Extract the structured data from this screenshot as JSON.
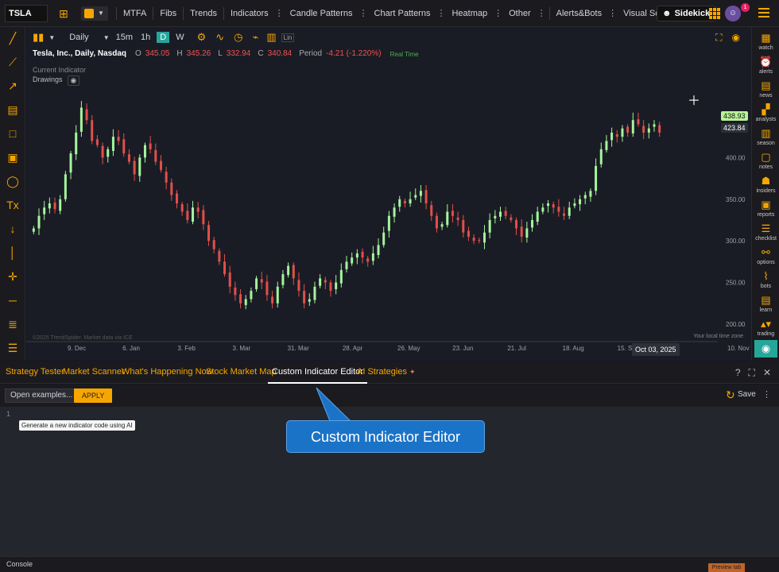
{
  "topbar": {
    "symbol": "TSLA",
    "mtfa": "MTFA",
    "fibs": "Fibs",
    "trends": "Trends",
    "indicators": "Indicators",
    "candle_patterns": "Candle Patterns",
    "chart_patterns": "Chart Patterns",
    "heatmap": "Heatmap",
    "other": "Other",
    "alerts_bots": "Alerts&Bots",
    "visual_scripts": "Visual Scripts",
    "sidekick": "Sidekick",
    "notification_count": "1",
    "accent_color": "#f7a600"
  },
  "chart_toolbar": {
    "interval": "Daily",
    "tf_15m": "15m",
    "tf_1h": "1h",
    "tf_d": "D",
    "tf_w": "W",
    "scale": "Lin"
  },
  "legend": {
    "title": "Tesla, Inc., Daily, Nasdaq",
    "o_label": "O",
    "o_value": "345.05",
    "h_label": "H",
    "h_value": "345.26",
    "l_label": "L",
    "l_value": "332.94",
    "c_label": "C",
    "c_value": "340.84",
    "period_label": "Period",
    "period_value": "-4.21 (-1.220%)",
    "realtime": "Real Time",
    "current_indicator": "Current Indicator",
    "drawings": "Drawings"
  },
  "chart_data": {
    "type": "candlestick",
    "x_ticks": [
      "9. Dec",
      "6. Jan",
      "3. Feb",
      "3. Mar",
      "31. Mar",
      "28. Apr",
      "26. May",
      "23. Jun",
      "21. Jul",
      "18. Aug",
      "15. Sep",
      "Oct 03, 2025",
      "10. Nov"
    ],
    "y_ticks": [
      450.0,
      400.0,
      350.0,
      300.0,
      250.0,
      200.0
    ],
    "ylim": [
      180,
      490
    ],
    "last_price": "438.93",
    "crosshair_price": "423.84",
    "closes": [
      315,
      330,
      340,
      345,
      338,
      350,
      380,
      405,
      430,
      460,
      445,
      420,
      415,
      400,
      410,
      425,
      420,
      405,
      395,
      380,
      400,
      415,
      410,
      395,
      385,
      370,
      355,
      345,
      335,
      325,
      340,
      335,
      320,
      300,
      290,
      275,
      260,
      245,
      235,
      225,
      230,
      240,
      255,
      250,
      235,
      225,
      245,
      260,
      270,
      255,
      240,
      225,
      230,
      245,
      255,
      250,
      240,
      250,
      265,
      275,
      280,
      285,
      280,
      275,
      285,
      295,
      310,
      330,
      340,
      350,
      345,
      350,
      355,
      360,
      345,
      330,
      315,
      320,
      335,
      330,
      325,
      310,
      305,
      300,
      300,
      310,
      325,
      330,
      335,
      330,
      325,
      315,
      305,
      315,
      325,
      335,
      340,
      345,
      340,
      335,
      330,
      340,
      345,
      350,
      355,
      360,
      390,
      410,
      420,
      430,
      425,
      435,
      430,
      445,
      440,
      430,
      435,
      440,
      430
    ]
  },
  "chart_labels": {
    "copyright": "©2025 TrendSpider. Market data via ICE",
    "timezone": "Your local time zone"
  },
  "rightbar": [
    "watch",
    "alerts",
    "news",
    "analysts",
    "season",
    "notes",
    "insiders",
    "reports",
    "checklist",
    "options",
    "bots",
    "learn",
    "trading"
  ],
  "tabs": {
    "strategy_tester": "Strategy Tester",
    "market_scanner": "Market Scanner",
    "whats_happening": "What's Happening Now",
    "stock_market_map": "Stock Market Map",
    "custom_indicator_editor": "Custom Indicator Editor",
    "ai_strategies": "AI Strategies"
  },
  "editor": {
    "open_examples": "Open examples...",
    "apply": "APPLY",
    "save": "Save",
    "line_number": "1",
    "ai_hint": "Generate a new indicator code using AI"
  },
  "callout": "Custom Indicator Editor",
  "console": {
    "label": "Console",
    "button": "Preview tab"
  }
}
